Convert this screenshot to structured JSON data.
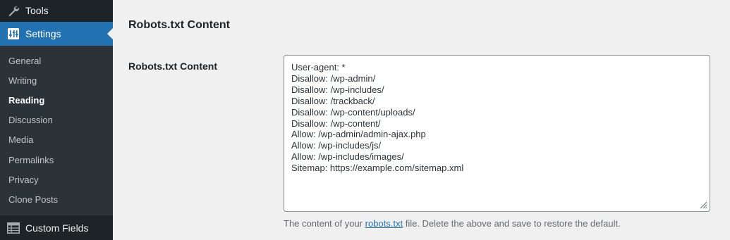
{
  "sidebar": {
    "tools": {
      "label": "Tools",
      "icon": "wrench-icon"
    },
    "settings": {
      "label": "Settings",
      "icon": "settings-sliders-icon",
      "active_color": "#2271b1"
    },
    "submenu": [
      {
        "label": "General",
        "current": false
      },
      {
        "label": "Writing",
        "current": false
      },
      {
        "label": "Reading",
        "current": true
      },
      {
        "label": "Discussion",
        "current": false
      },
      {
        "label": "Media",
        "current": false
      },
      {
        "label": "Permalinks",
        "current": false
      },
      {
        "label": "Privacy",
        "current": false
      },
      {
        "label": "Clone Posts",
        "current": false
      }
    ],
    "custom_fields": {
      "label": "Custom Fields",
      "icon": "table-icon"
    }
  },
  "main": {
    "section_title": "Robots.txt Content",
    "field_label": "Robots.txt Content",
    "textarea_value": "User-agent: *\nDisallow: /wp-admin/\nDisallow: /wp-includes/\nDisallow: /trackback/\nDisallow: /wp-content/uploads/\nDisallow: /wp-content/\nAllow: /wp-admin/admin-ajax.php\nAllow: /wp-includes/js/\nAllow: /wp-includes/images/\nSitemap: https://example.com/sitemap.xml",
    "description_before": "The content of your ",
    "description_link": "robots.txt",
    "description_after": " file. Delete the above and save to restore the default."
  }
}
